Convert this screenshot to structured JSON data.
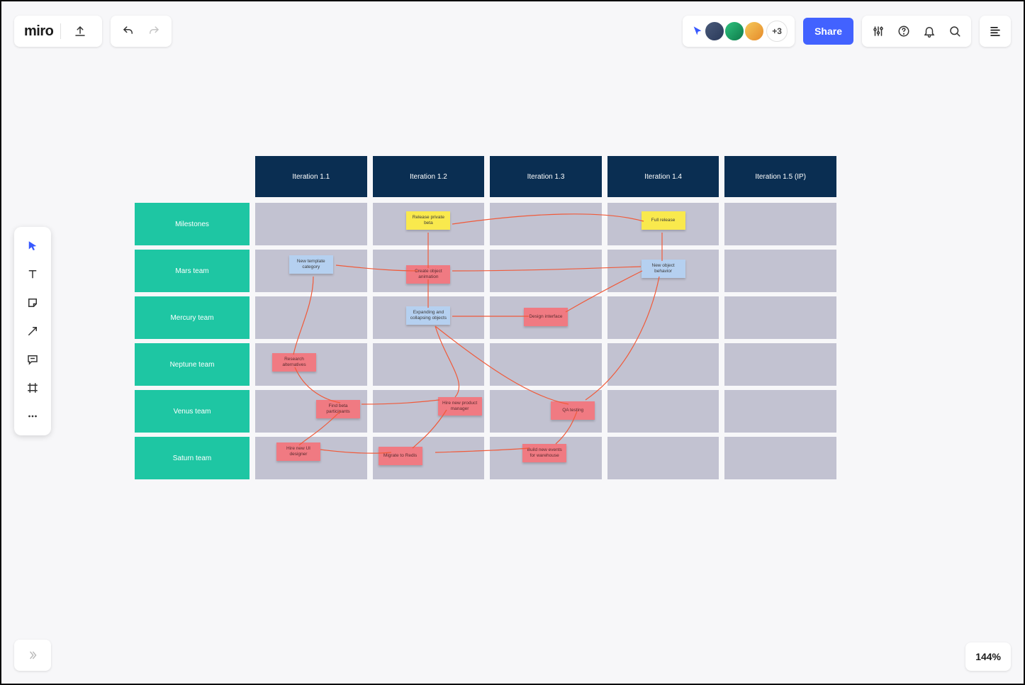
{
  "app": {
    "logo_text": "miro"
  },
  "toolbar": {
    "share_label": "Share",
    "overflow_count": "+3",
    "zoom_label": "144%"
  },
  "board": {
    "columns": [
      "Iteration 1.1",
      "Iteration 1.2",
      "Iteration 1.3",
      "Iteration 1.4",
      "Iteration 1.5 (IP)"
    ],
    "rows": [
      "Milestones",
      "Mars team",
      "Mercury team",
      "Neptune team",
      "Venus team",
      "Saturn team"
    ],
    "notes": {
      "release_private_beta": "Release private beta",
      "full_release": "Full release",
      "new_template_category": "New template category",
      "create_object_animation": "Create object animation",
      "new_object_behavior": "New object behavior",
      "expanding_collapsing": "Expanding and collapsing objects",
      "design_interface": "Design interface",
      "research_alternatives": "Research alternatives",
      "find_beta_participants": "Find beta participants",
      "hire_new_pm": "Hire new product manager",
      "qa_testing": "QA testing",
      "hire_new_ui_designer": "Hire new UI designer",
      "migrate_to_redis": "Migrate to Redis",
      "build_new_events": "Build new events for warehouse"
    }
  }
}
